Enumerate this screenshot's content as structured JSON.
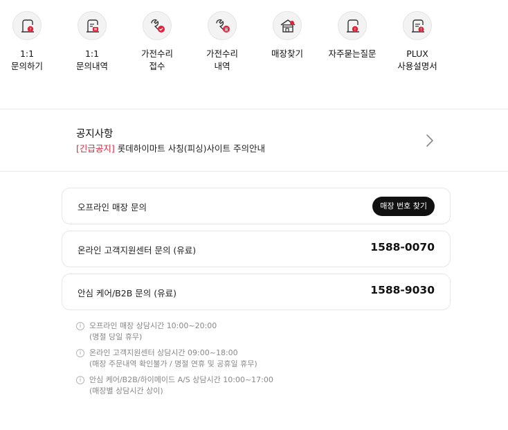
{
  "quick_menu": [
    {
      "icon": "inquiry-question-icon",
      "label": "1:1\n문의하기"
    },
    {
      "icon": "inquiry-list-icon",
      "label": "1:1\n문의내역"
    },
    {
      "icon": "repair-check-icon",
      "label": "가전수리\n접수"
    },
    {
      "icon": "repair-list-icon",
      "label": "가전수리\n내역"
    },
    {
      "icon": "store-finder-icon",
      "label": "매장찾기"
    },
    {
      "icon": "faq-icon",
      "label": "자주묻는질문"
    },
    {
      "icon": "manual-icon",
      "label": "PLUX\n사용설명서"
    }
  ],
  "notice": {
    "title": "공지사항",
    "tag": "[긴급공지]",
    "text": " 롯데하이마트 사칭(피싱)사이트 주의안내"
  },
  "contacts": {
    "offline": {
      "label": "오프라인 매장 문의",
      "button": "매장 번호 찾기"
    },
    "online": {
      "label": "온라인 고객지원센터 문의 (유료)",
      "phone": "1588-0070"
    },
    "care": {
      "label": "안심 케어/B2B 문의 (유료)",
      "phone": "1588-9030"
    }
  },
  "info": [
    "오프라인 매장 상담시간 10:00~20:00\n(명절 당일 휴무)",
    "온라인 고객지원센터 상담시간 09:00~18:00\n(매장 주문내역 확인불가 / 명절 연휴 및 공휴일 휴무)",
    "안심 케어/B2B/하이메이드 A/S 상담시간 10:00~17:00\n(매장별 상담시간 상이)"
  ],
  "colors": {
    "accent": "#e5203a",
    "button_bg": "#111111",
    "border": "#e6e6e6",
    "muted_text": "#888888"
  }
}
